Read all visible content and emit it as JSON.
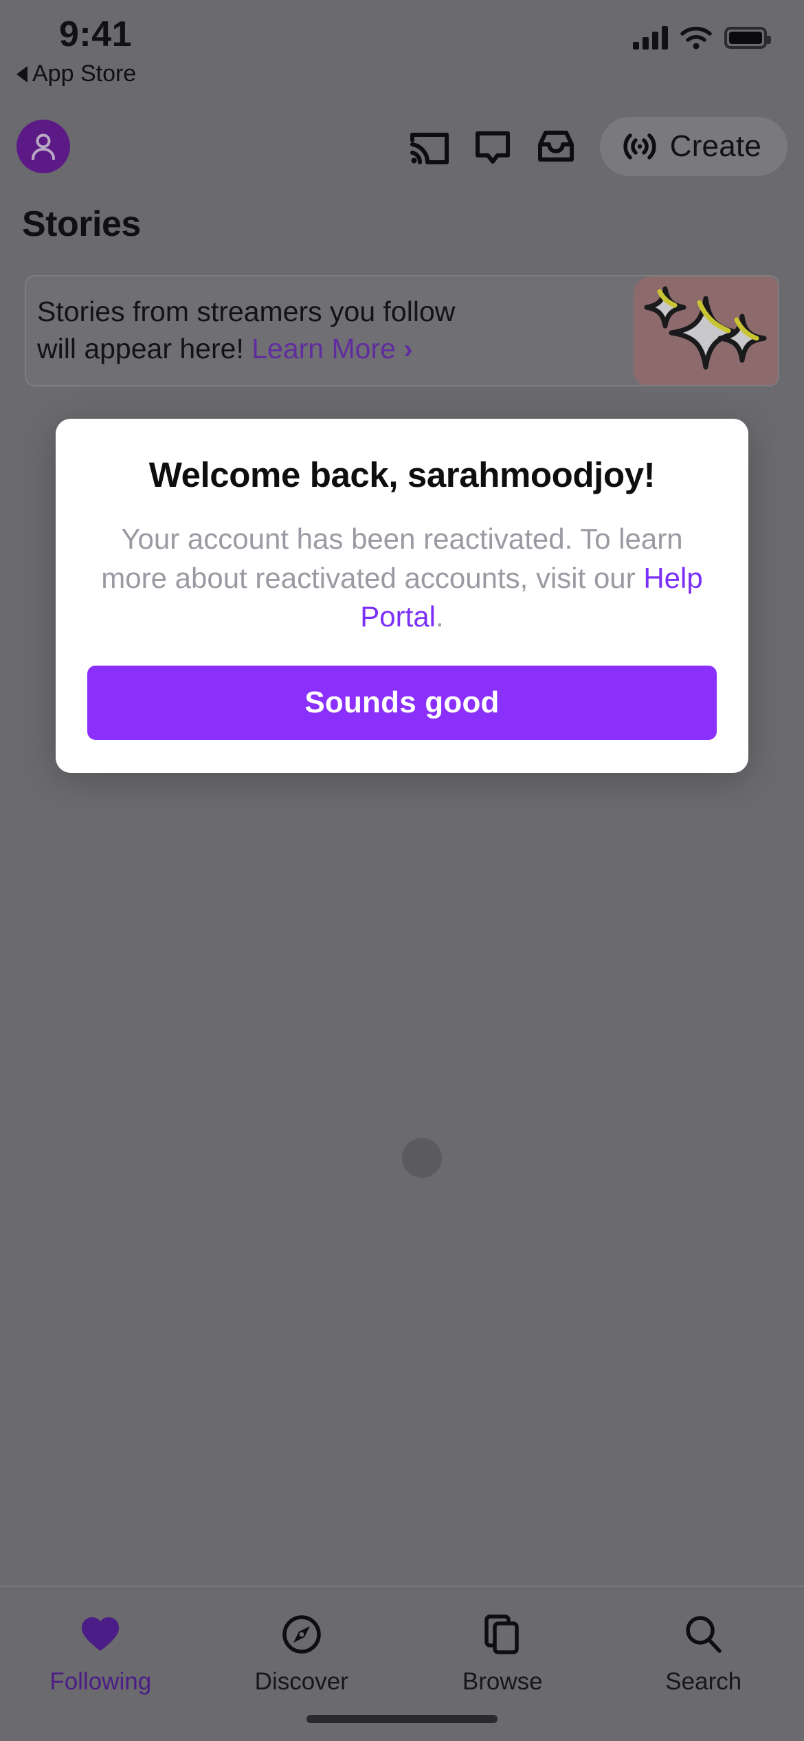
{
  "status_bar": {
    "time": "9:41",
    "back_label": "App Store",
    "signal_icon": "signal-bars-icon",
    "wifi_icon": "wifi-icon",
    "battery_icon": "battery-icon"
  },
  "top_nav": {
    "avatar_icon": "user-avatar-icon",
    "avatar_color": "#5b1a86",
    "cast_icon": "cast-icon",
    "whispers_icon": "chat-bubble-icon",
    "inbox_icon": "inbox-icon",
    "create_icon": "broadcast-icon",
    "create_label": "Create"
  },
  "stories": {
    "heading": "Stories",
    "banner_text_line1": "Stories from streamers you follow",
    "banner_text_line2": "will appear here!",
    "banner_link": "Learn More",
    "banner_chevron": "›",
    "banner_art_icon": "sparkles-icon",
    "banner_art_bg": "#8d6b6d"
  },
  "loading": {
    "spinner_icon": "loading-spinner-icon"
  },
  "modal": {
    "title": "Welcome back, sarahmoodjoy!",
    "body_part1": "Your account has been reactivated. To learn more about reactivated accounts, visit our ",
    "body_link": "Help Portal",
    "body_part2": ".",
    "primary_button": "Sounds good",
    "primary_button_color": "#8b2ffb",
    "link_color": "#7b2ff7"
  },
  "tab_bar": {
    "active_color": "#4b1d86",
    "items": [
      {
        "label": "Following",
        "icon": "heart-icon",
        "active": true
      },
      {
        "label": "Discover",
        "icon": "compass-icon",
        "active": false
      },
      {
        "label": "Browse",
        "icon": "cards-stack-icon",
        "active": false
      },
      {
        "label": "Search",
        "icon": "magnifier-icon",
        "active": false
      }
    ]
  }
}
